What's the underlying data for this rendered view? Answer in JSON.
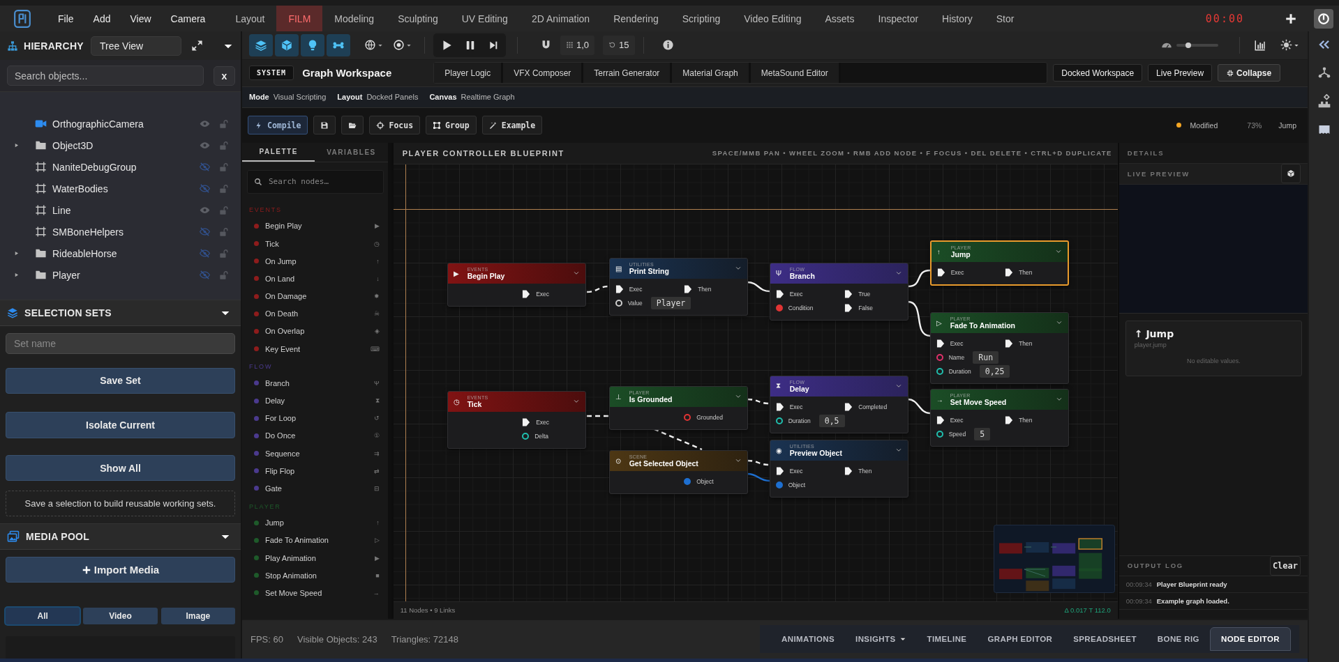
{
  "menus": [
    "File",
    "Add",
    "View",
    "Camera"
  ],
  "workspace_tabs": [
    {
      "label": "Layout",
      "selected": false
    },
    {
      "label": "FILM",
      "selected": true
    },
    {
      "label": "Modeling",
      "selected": false
    },
    {
      "label": "Sculpting",
      "selected": false
    },
    {
      "label": "UV Editing",
      "selected": false
    },
    {
      "label": "2D Animation",
      "selected": false
    },
    {
      "label": "Rendering",
      "selected": false
    },
    {
      "label": "Scripting",
      "selected": false
    },
    {
      "label": "Video Editing",
      "selected": false
    },
    {
      "label": "Assets",
      "selected": false
    },
    {
      "label": "Inspector",
      "selected": false
    },
    {
      "label": "History",
      "selected": false
    },
    {
      "label": "Stor",
      "selected": false
    }
  ],
  "timer": "00:00",
  "hierarchy": {
    "title": "HIERARCHY",
    "view": "Tree View",
    "search_placeholder": "Search objects...",
    "clear": "x",
    "items": [
      {
        "kind": "camera",
        "name": "OrthographicCamera",
        "visible": true
      },
      {
        "kind": "folder",
        "name": "Object3D",
        "visible": true,
        "expanded": false
      },
      {
        "kind": "group",
        "name": "NaniteDebugGroup",
        "visible": false
      },
      {
        "kind": "group",
        "name": "WaterBodies",
        "visible": false
      },
      {
        "kind": "group",
        "name": "Line",
        "visible": true
      },
      {
        "kind": "group",
        "name": "SMBoneHelpers",
        "visible": false
      },
      {
        "kind": "folder",
        "name": "RideableHorse",
        "visible": false,
        "expanded": false
      },
      {
        "kind": "folder",
        "name": "Player",
        "visible": false,
        "expanded": false
      }
    ]
  },
  "selection_sets": {
    "title": "SELECTION SETS",
    "name_placeholder": "Set name",
    "buttons": [
      "Save Set",
      "Isolate Current",
      "Show All"
    ],
    "hint": "Save a selection to build reusable working sets."
  },
  "media_pool": {
    "title": "MEDIA POOL",
    "import_label": "Import Media",
    "filters": [
      {
        "label": "All",
        "selected": true
      },
      {
        "label": "Video",
        "selected": false
      },
      {
        "label": "Image",
        "selected": false
      }
    ]
  },
  "toolbar": {
    "view_toggles": [
      {
        "kind": "layers",
        "on": true
      },
      {
        "kind": "cube",
        "on": true
      },
      {
        "kind": "bulb",
        "on": true
      },
      {
        "kind": "bone",
        "on": true
      }
    ],
    "snap": "1,0",
    "angle": "15",
    "zoom_slider": {
      "level": 0.25
    }
  },
  "workspace": {
    "badge": "SYSTEM",
    "title": "Graph Workspace",
    "tabs": [
      {
        "label": "Player Logic",
        "selected": false
      },
      {
        "label": "VFX Composer",
        "selected": false
      },
      {
        "label": "Terrain Generator",
        "selected": false
      },
      {
        "label": "Material Graph",
        "selected": false
      },
      {
        "label": "MetaSound Editor",
        "selected": false
      }
    ],
    "buttons": [
      {
        "kind": "plain",
        "label": "Docked Workspace"
      },
      {
        "kind": "plain",
        "label": "Live Preview"
      },
      {
        "kind": "collapse",
        "label": "Collapse"
      }
    ],
    "properties": [
      {
        "label": "Mode",
        "value": "Visual Scripting"
      },
      {
        "label": "Layout",
        "value": "Docked Panels"
      },
      {
        "label": "Canvas",
        "value": "Realtime Graph"
      }
    ],
    "actions": [
      {
        "kind": "compile",
        "label": "Compile"
      },
      {
        "kind": "save"
      },
      {
        "kind": "open"
      },
      {
        "kind": "focus",
        "label": "Focus"
      },
      {
        "kind": "group",
        "label": "Group"
      },
      {
        "kind": "example",
        "label": "Example"
      }
    ],
    "status": {
      "state": "Modified",
      "zoom": "73%",
      "selection": "Jump"
    }
  },
  "palette": {
    "tabs": [
      {
        "label": "PALETTE",
        "selected": true
      },
      {
        "label": "VARIABLES",
        "selected": false
      }
    ],
    "search_placeholder": "Search nodes…",
    "sections": [
      {
        "title": "EVENTS",
        "color": "#8e1c1c",
        "items": [
          {
            "name": "Begin Play",
            "icon": "▶"
          },
          {
            "name": "Tick",
            "icon": "◷"
          },
          {
            "name": "On Jump",
            "icon": "↑"
          },
          {
            "name": "On Land",
            "icon": "↓"
          },
          {
            "name": "On Damage",
            "icon": "✸"
          },
          {
            "name": "On Death",
            "icon": "☠"
          },
          {
            "name": "On Overlap",
            "icon": "◈"
          },
          {
            "name": "Key Event",
            "icon": "⌨"
          }
        ]
      },
      {
        "title": "FLOW",
        "color": "#4b3a8e",
        "items": [
          {
            "name": "Branch",
            "icon": "Ψ"
          },
          {
            "name": "Delay",
            "icon": "⧗"
          },
          {
            "name": "For Loop",
            "icon": "↺"
          },
          {
            "name": "Do Once",
            "icon": "①"
          },
          {
            "name": "Sequence",
            "icon": "⇉"
          },
          {
            "name": "Flip Flop",
            "icon": "⇄"
          },
          {
            "name": "Gate",
            "icon": "⊟"
          }
        ]
      },
      {
        "title": "PLAYER",
        "color": "#1e5a2a",
        "items": [
          {
            "name": "Jump",
            "icon": "↑"
          },
          {
            "name": "Fade To Animation",
            "icon": "▷"
          },
          {
            "name": "Play Animation",
            "icon": "▶"
          },
          {
            "name": "Stop Animation",
            "icon": "■"
          },
          {
            "name": "Set Move Speed",
            "icon": "→"
          }
        ]
      }
    ]
  },
  "graph": {
    "title": "PLAYER CONTROLLER BLUEPRINT",
    "hints": "SPACE/MMB PAN • WHEEL ZOOM • RMB ADD NODE • F FOCUS • DEL DELETE • CTRL+D DUPLICATE",
    "counts": "11 Nodes • 9 Links",
    "stats": "Δ 0.017 T 112.0",
    "nodes": [
      {
        "kind": "events",
        "category": "EVENTS",
        "title": "Begin Play",
        "icon": "▶",
        "selected": false,
        "rows": [
          {
            "right": {
              "kind": "exec",
              "label": "Exec"
            }
          }
        ]
      },
      {
        "kind": "utilities",
        "category": "UTILITIES",
        "title": "Print String",
        "icon": "▤",
        "selected": false,
        "rows": [
          {
            "left": {
              "kind": "exec",
              "label": "Exec"
            },
            "right": {
              "kind": "exec",
              "label": "Then"
            }
          },
          {
            "left": {
              "kind": "data",
              "label": "Value",
              "color": "#cfcfcf",
              "filled": false,
              "value": "Player"
            }
          }
        ]
      },
      {
        "kind": "flow",
        "category": "FLOW",
        "title": "Branch",
        "icon": "Ψ",
        "selected": false,
        "rows": [
          {
            "left": {
              "kind": "exec",
              "label": "Exec"
            },
            "right": {
              "kind": "exec",
              "label": "True"
            }
          },
          {
            "left": {
              "kind": "data",
              "label": "Condition",
              "color": "#e03434",
              "filled": true
            },
            "right": {
              "kind": "exec",
              "label": "False"
            }
          }
        ]
      },
      {
        "kind": "player",
        "category": "PLAYER",
        "title": "Jump",
        "icon": "↑",
        "selected": true,
        "rows": [
          {
            "left": {
              "kind": "exec",
              "label": "Exec"
            },
            "right": {
              "kind": "exec",
              "label": "Then"
            }
          }
        ]
      },
      {
        "kind": "player",
        "category": "PLAYER",
        "title": "Fade To Animation",
        "icon": "▷",
        "selected": false,
        "rows": [
          {
            "left": {
              "kind": "exec",
              "label": "Exec"
            },
            "right": {
              "kind": "exec",
              "label": "Then"
            }
          },
          {
            "left": {
              "kind": "data",
              "label": "Name",
              "color": "#e0306a",
              "filled": false,
              "value": "Run"
            }
          },
          {
            "left": {
              "kind": "data",
              "label": "Duration",
              "color": "#20bfae",
              "filled": false,
              "value": "0,25"
            }
          }
        ]
      },
      {
        "kind": "events",
        "category": "EVENTS",
        "title": "Tick",
        "icon": "◷",
        "selected": false,
        "rows": [
          {
            "right": {
              "kind": "exec",
              "label": "Exec"
            }
          },
          {
            "right": {
              "kind": "data",
              "label": "Delta",
              "color": "#20bfae",
              "filled": false
            }
          }
        ]
      },
      {
        "kind": "player",
        "category": "PLAYER",
        "title": "Is Grounded",
        "icon": "⊥",
        "selected": false,
        "rows": [
          {
            "right": {
              "kind": "data",
              "label": "Grounded",
              "color": "#e03434",
              "filled": false
            }
          }
        ]
      },
      {
        "kind": "scene",
        "category": "SCENE",
        "title": "Get Selected Object",
        "icon": "⊙",
        "selected": false,
        "rows": [
          {
            "right": {
              "kind": "data",
              "label": "Object",
              "color": "#1e6fd0",
              "filled": true
            }
          }
        ]
      },
      {
        "kind": "flow",
        "category": "FLOW",
        "title": "Delay",
        "icon": "⧗",
        "selected": false,
        "rows": [
          {
            "left": {
              "kind": "exec",
              "label": "Exec"
            },
            "right": {
              "kind": "exec",
              "label": "Completed"
            }
          },
          {
            "left": {
              "kind": "data",
              "label": "Duration",
              "color": "#20bfae",
              "filled": false,
              "value": "0,5"
            }
          }
        ]
      },
      {
        "kind": "utilities",
        "category": "UTILITIES",
        "title": "Preview Object",
        "icon": "◉",
        "selected": false,
        "rows": [
          {
            "left": {
              "kind": "exec",
              "label": "Exec"
            },
            "right": {
              "kind": "exec",
              "label": "Then"
            }
          },
          {
            "left": {
              "kind": "data",
              "label": "Object",
              "color": "#1e6fd0",
              "filled": true
            }
          }
        ]
      },
      {
        "kind": "player",
        "category": "PLAYER",
        "title": "Set Move Speed",
        "icon": "→",
        "selected": false,
        "rows": [
          {
            "left": {
              "kind": "exec",
              "label": "Exec"
            },
            "right": {
              "kind": "exec",
              "label": "Then"
            }
          },
          {
            "left": {
              "kind": "data",
              "label": "Speed",
              "color": "#20bfae",
              "filled": false,
              "value": "5"
            }
          }
        ]
      }
    ]
  },
  "details": {
    "title": "DETAILS",
    "preview_title": "LIVE PREVIEW",
    "card": {
      "title": "↑ Jump",
      "subtitle": "player.jump",
      "note": "No editable values."
    },
    "log_title": "OUTPUT LOG",
    "clear": "Clear",
    "log": [
      {
        "time": "00:09:34",
        "message": "Player Blueprint ready"
      },
      {
        "time": "00:09:34",
        "message": "Example graph loaded."
      }
    ]
  },
  "status_bar": {
    "stats": [
      "FPS: 60",
      "Visible Objects: 243",
      "Triangles: 72148"
    ],
    "tabs": [
      {
        "kind": "tab",
        "label": "ANIMATIONS",
        "selected": false
      },
      {
        "kind": "menu",
        "label": "INSIGHTS",
        "selected": false
      },
      {
        "kind": "tab",
        "label": "TIMELINE",
        "selected": false
      },
      {
        "kind": "tab",
        "label": "GRAPH EDITOR",
        "selected": false
      },
      {
        "kind": "tab",
        "label": "SPREADSHEET",
        "selected": false
      },
      {
        "kind": "tab",
        "label": "BONE RIG",
        "selected": false
      },
      {
        "kind": "tab",
        "label": "NODE EDITOR",
        "selected": true
      }
    ]
  }
}
